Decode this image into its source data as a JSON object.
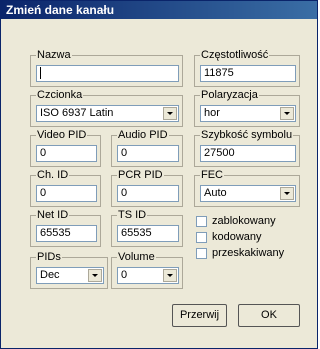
{
  "window": {
    "title": "Zmień dane kanału"
  },
  "fields": {
    "nazwa": {
      "label": "Nazwa",
      "value": ""
    },
    "czestotliwosc": {
      "label": "Częstotliwość",
      "value": "11875"
    },
    "czcionka": {
      "label": "Czcionka",
      "value": "ISO 6937 Latin"
    },
    "polaryzacja": {
      "label": "Polaryzacja",
      "value": "hor"
    },
    "video_pid": {
      "label": "Video PID",
      "value": "0"
    },
    "audio_pid": {
      "label": "Audio PID",
      "value": "0"
    },
    "szybkosc_symbolu": {
      "label": "Szybkość symbolu",
      "value": "27500"
    },
    "ch_id": {
      "label": "Ch. ID",
      "value": "0"
    },
    "pcr_pid": {
      "label": "PCR PID",
      "value": "0"
    },
    "fec": {
      "label": "FEC",
      "value": "Auto"
    },
    "net_id": {
      "label": "Net ID",
      "value": "65535"
    },
    "ts_id": {
      "label": "TS ID",
      "value": "65535"
    },
    "pids": {
      "label": "PIDs",
      "value": "Dec"
    },
    "volume": {
      "label": "Volume",
      "value": "0"
    }
  },
  "checkboxes": {
    "zablokowany": {
      "label": "zablokowany",
      "checked": false
    },
    "kodowany": {
      "label": "kodowany",
      "checked": false
    },
    "przeskakiwany": {
      "label": "przeskakiwany",
      "checked": false
    }
  },
  "buttons": {
    "cancel": "Przerwij",
    "ok": "OK"
  }
}
